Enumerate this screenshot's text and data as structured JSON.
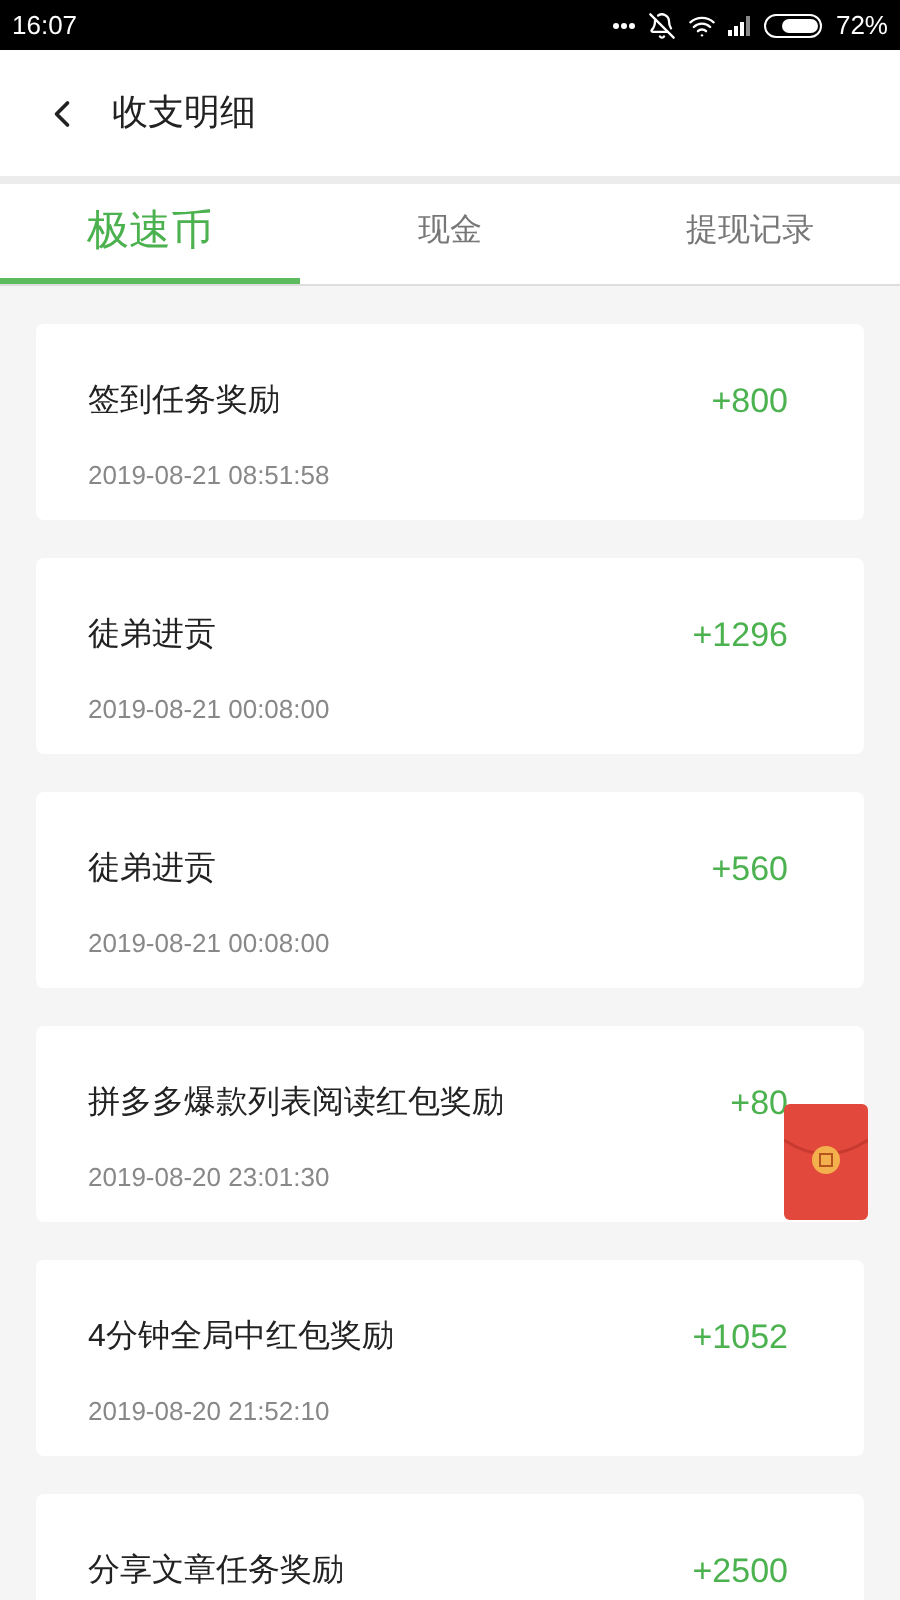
{
  "status_bar": {
    "time": "16:07",
    "battery": "72%"
  },
  "header": {
    "title": "收支明细"
  },
  "tabs": [
    {
      "label": "极速币",
      "selected": true
    },
    {
      "label": "现金",
      "selected": false
    },
    {
      "label": "提现记录",
      "selected": false
    }
  ],
  "records": [
    {
      "title": "签到任务奖励",
      "time": "2019-08-21 08:51:58",
      "amount": "+800"
    },
    {
      "title": "徒弟进贡",
      "time": "2019-08-21 00:08:00",
      "amount": "+1296"
    },
    {
      "title": "徒弟进贡",
      "time": "2019-08-21 00:08:00",
      "amount": "+560"
    },
    {
      "title": "拼多多爆款列表阅读红包奖励",
      "time": "2019-08-20 23:01:30",
      "amount": "+80"
    },
    {
      "title": "4分钟全局中红包奖励",
      "time": "2019-08-20 21:52:10",
      "amount": "+1052"
    },
    {
      "title": "分享文章任务奖励",
      "amount": "+2500"
    }
  ]
}
